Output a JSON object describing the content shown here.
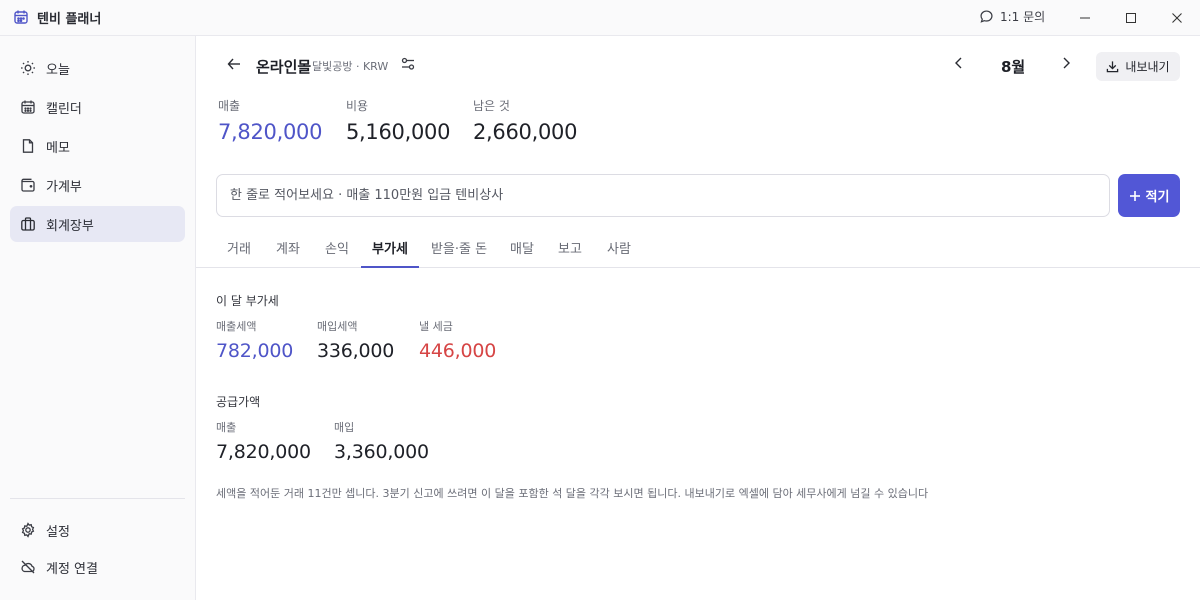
{
  "app": {
    "title": "텐비 플래너"
  },
  "titlebar": {
    "help_label": "1:1 문의"
  },
  "sidebar": {
    "items": [
      {
        "label": "오늘",
        "icon": "sun-icon"
      },
      {
        "label": "캘린더",
        "icon": "calendar-icon"
      },
      {
        "label": "메모",
        "icon": "file-icon"
      },
      {
        "label": "가계부",
        "icon": "wallet-icon"
      },
      {
        "label": "회계장부",
        "icon": "briefcase-icon",
        "active": true
      }
    ],
    "footer": [
      {
        "label": "설정",
        "icon": "gear-icon"
      },
      {
        "label": "계정 연결",
        "icon": "cloud-off-icon"
      }
    ]
  },
  "header": {
    "account_name": "온라인몰",
    "account_sub": "달빛공방 · KRW",
    "month": "8월",
    "export_label": "내보내기"
  },
  "summary": {
    "revenue_label": "매출",
    "revenue_value": "7,820,000",
    "expense_label": "비용",
    "expense_value": "5,160,000",
    "remaining_label": "남은 것",
    "remaining_value": "2,660,000"
  },
  "quick_entry": {
    "placeholder": "한 줄로 적어보세요 · 매출 110만원 입금 텐비상사",
    "add_label": "적기"
  },
  "tabs": [
    "거래",
    "계좌",
    "손익",
    "부가세",
    "받을·줄 돈",
    "매달",
    "보고",
    "사람"
  ],
  "active_tab": "부가세",
  "vat": {
    "section_title": "이 달 부가세",
    "sales_tax_label": "매출세액",
    "sales_tax_value": "782,000",
    "purchase_tax_label": "매입세액",
    "purchase_tax_value": "336,000",
    "payable_label": "낼 세금",
    "payable_value": "446,000"
  },
  "supply": {
    "section_title": "공급가액",
    "sales_label": "매출",
    "sales_value": "7,820,000",
    "purchase_label": "매입",
    "purchase_value": "3,360,000"
  },
  "note": "세액을 적어둔 거래 11건만 셉니다. 3분기 신고에 쓰려면 이 달을 포함한 석 달을 각각 보시면 됩니다. 내보내기로 엑셀에 담아 세무사에게 넘길 수 있습니다",
  "colors": {
    "accent": "#4f55c8",
    "button": "#5257d6",
    "danger": "#d64545"
  }
}
